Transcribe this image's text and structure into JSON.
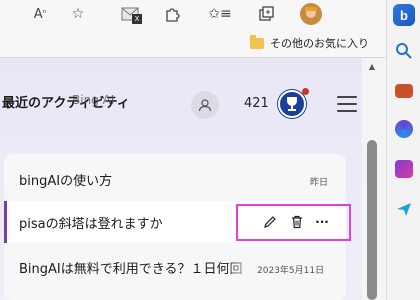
{
  "toolbar": {
    "icons": [
      "read-aloud-icon",
      "add-favorite-icon",
      "mail-icon",
      "extensions-icon",
      "favorites-icon",
      "collections-icon",
      "profile-avatar",
      "bing-icon"
    ],
    "mail_badge": "X"
  },
  "favorites_bar": {
    "folder_label": "その他のお気に入り"
  },
  "panel": {
    "title_main": "最近のアクティビティ",
    "title_overlap": "Bing AI",
    "points": "421",
    "colors": {
      "accent": "#7b3ea1",
      "highlight": "#e040e0",
      "rewards": "#1c3e9c"
    }
  },
  "list": {
    "items": [
      {
        "title": "bingAIの使い方",
        "date": "昨日"
      },
      {
        "title": "pisaの斜塔は登れますか",
        "date": ""
      },
      {
        "title": "BingAIは無料で利用できる？１日何回",
        "date": "2023年5月11日"
      }
    ],
    "actions": [
      "edit-icon",
      "delete-icon",
      "more-icon"
    ]
  },
  "sidebar": {
    "icons": [
      "search-icon",
      "briefcase-icon",
      "copilot-icon",
      "designer-icon",
      "send-icon"
    ]
  }
}
